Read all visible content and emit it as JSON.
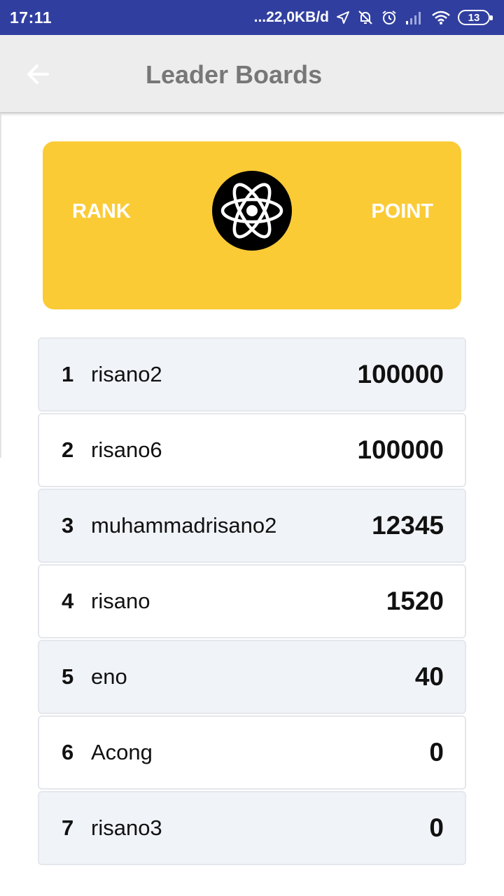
{
  "status_bar": {
    "time": "17:11",
    "network_speed": "...22,0KB/d",
    "battery": "13"
  },
  "app_bar": {
    "title": "Leader Boards"
  },
  "header": {
    "rank_label": "RANK",
    "point_label": "POINT"
  },
  "leaderboard": [
    {
      "rank": "1",
      "name": "risano2",
      "points": "100000"
    },
    {
      "rank": "2",
      "name": "risano6",
      "points": "100000"
    },
    {
      "rank": "3",
      "name": "muhammadrisano2",
      "points": "12345"
    },
    {
      "rank": "4",
      "name": "risano",
      "points": "1520"
    },
    {
      "rank": "5",
      "name": "eno",
      "points": "40"
    },
    {
      "rank": "6",
      "name": "Acong",
      "points": "0"
    },
    {
      "rank": "7",
      "name": "risano3",
      "points": "0"
    }
  ],
  "colors": {
    "status_bar": "#303f9f",
    "header_card": "#fbcb36",
    "row_alt": "#f0f3f7"
  }
}
